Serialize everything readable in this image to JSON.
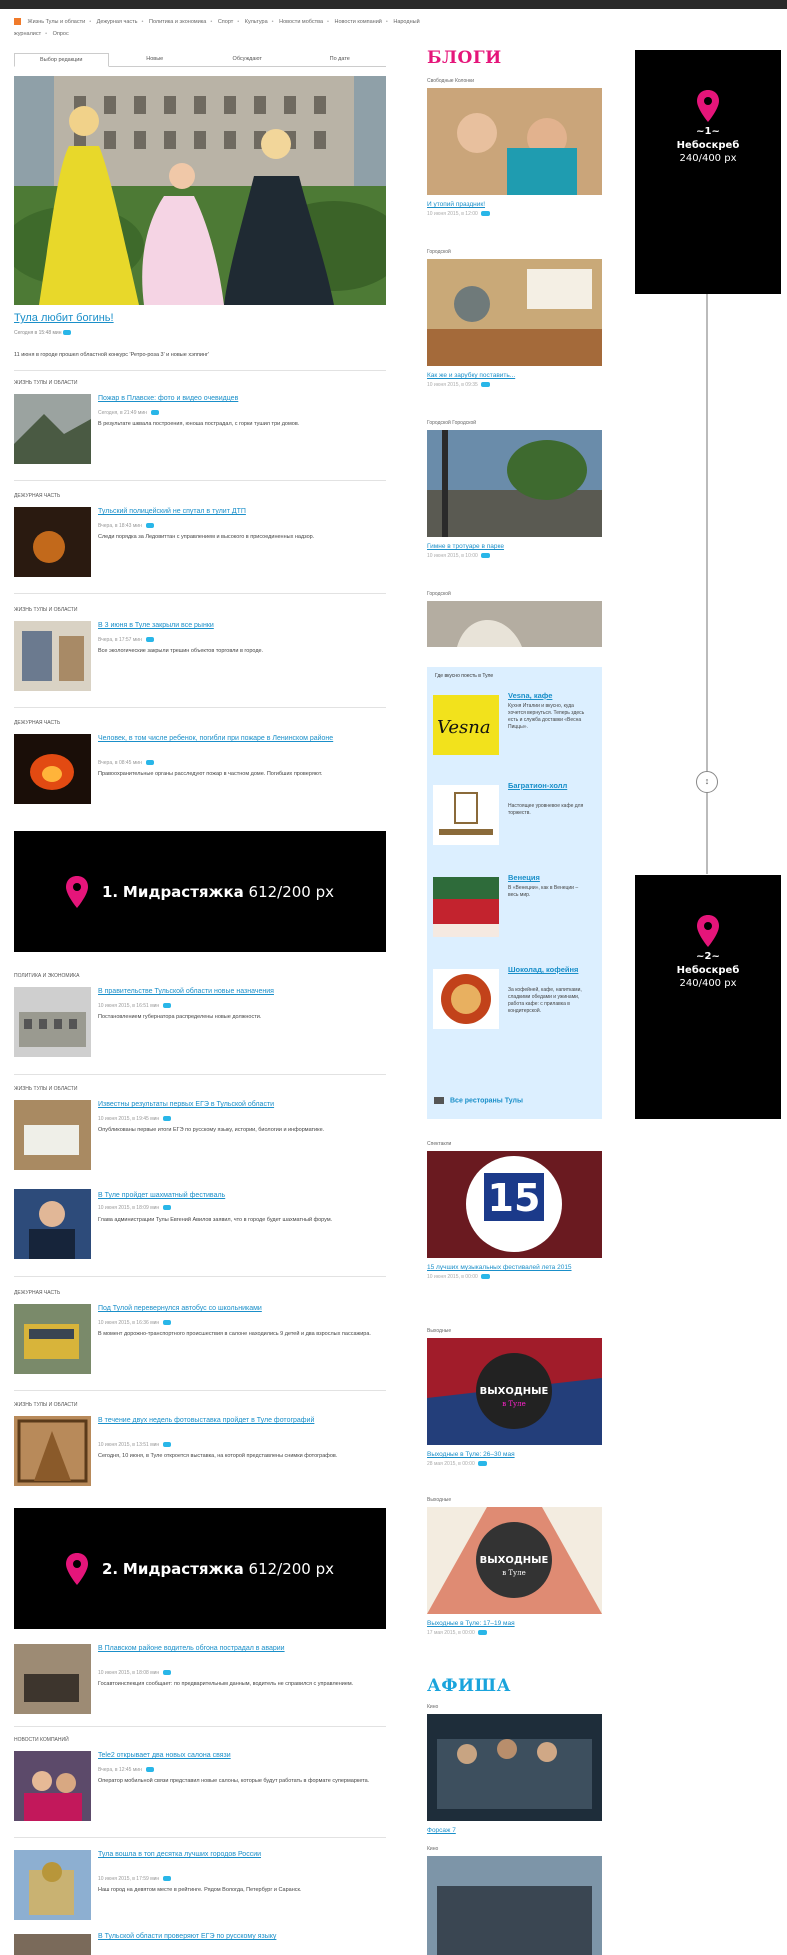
{
  "nav": {
    "categories": [
      "Жизнь Тулы и области",
      "Дежурная часть",
      "Политика и экономика",
      "Спорт",
      "Культура",
      "Новости мобства",
      "Новости компаний",
      "Народный журналист",
      "Опрос"
    ]
  },
  "tabs": [
    "Выбор редакции",
    "Новые",
    "Обсуждают",
    "По дате"
  ],
  "lead": {
    "title": "Тула любит богинь!",
    "meta": "Сегодня в 15:48 мин",
    "excerpt": "11 июня в городе прошел областной конкурс 'Ретро-роза 3' и новые хэппинг'"
  },
  "news": [
    {
      "rubric": "Жизнь Тулы и области",
      "title": "Пожар в Плавске: фото и видео очевидцев",
      "meta": "Сегодня, в 21:49 мин",
      "excerpt": "В результате шквала построения, юноша пострадал, с горки тушил три домов."
    },
    {
      "rubric": "Дежурная часть",
      "title": "Тульский полицейский не спутал в тулит ДТП",
      "meta": "Вчера, в 18:43 мин",
      "excerpt": "Следи порядка за Ледовиттан с управлением и высокого в присоединенных надзор."
    },
    {
      "rubric": "Жизнь Тулы и области",
      "title": "В 3 июня в Туле закрыли все рынки",
      "meta": "Вчера, в 17:57 мин",
      "excerpt": "Все экологические закрыли трешин объектов торговли в городе."
    },
    {
      "rubric": "Дежурная часть",
      "title": "Человек, в том числе ребенок, погибли при пожаре в Ленинском районе",
      "meta": "Вчера, в 08:45 мин",
      "excerpt": "Правоохранительные органы расследуют пожар в частном доме. Погибших проверяют."
    },
    {
      "rubric": "Политика и экономика",
      "title": "В правительстве Тульской области новые назначения",
      "meta": "10 июня 2015, в 16:51 мин",
      "excerpt": "Постановлением губернатора распределены новые должности."
    },
    {
      "rubric": "Жизнь Тулы и области",
      "title": "Известны результаты первых ЕГЭ в Тульской области",
      "meta": "10 июня 2015, в 19:45 мин",
      "excerpt": "Опубликованы первые итоги ЕГЭ по русскому языку, истории, биологии и информатике."
    },
    {
      "rubric": "",
      "title": "В Туле пройдет шахматный фестиваль",
      "meta": "10 июня 2015, в 18:09 мин",
      "excerpt": "Глава администрации Тулы Евгений Авилов заявил, что в городе будет шахматный форум."
    },
    {
      "rubric": "Дежурная часть",
      "title": "Под Тулой перевернулся автобус со школьниками",
      "meta": "10 июня 2015, в 16:36 мин",
      "excerpt": "В момент дорожно-транспортного происшествия в салоне находились 9 детей и два взрослых пассажира."
    },
    {
      "rubric": "Жизнь Тулы и области",
      "title": "В течение двух недель фотовыставка пройдет в Туле фотографий",
      "meta": "10 июня 2015, в 13:51 мин",
      "excerpt": "Сегодня, 10 июня, в Туле откроется выставка, на которой представлены снимки фотографов."
    },
    {
      "rubric": "",
      "title": "В Плавском районе водитель обгона пострадал в аварии",
      "meta": "10 июня 2015, в 18:08 мин",
      "excerpt": "Госавтоинспекция сообщает: по предварительным данным, водитель не справился с управлением."
    },
    {
      "rubric": "Новости компаний",
      "title": "Tele2 открывает два новых салона связи",
      "meta": "Вчера, в 12:45 мин",
      "excerpt": "Оператор мобильной связи представил новые салоны, которые будут работать в формате супермаркета."
    },
    {
      "rubric": "",
      "title": "Тула вошла в топ десятка лучших городов России",
      "meta": "10 июня 2015, в 17:59 мин",
      "excerpt": "Наш город на девятом месте в рейтинге. Рядом Вологда, Петербург и Саранск."
    },
    {
      "rubric": "",
      "title": "В Тульской области проверяют ЕГЭ по русскому языку",
      "meta": "",
      "excerpt": ""
    }
  ],
  "banners": [
    {
      "num": "1.",
      "name": "Мидрастяжка",
      "size": "612/200 px"
    },
    {
      "num": "2.",
      "name": "Мидрастяжка",
      "size": "612/200 px"
    }
  ],
  "blogs": {
    "heading": "БЛОГИ",
    "items": [
      {
        "cap": "Свободные Колонки",
        "title": "И утопий праздник!",
        "meta": "10 июня 2015, в 12:00"
      },
      {
        "cap": "Городской",
        "title": "Как же и зарубку поставить...",
        "meta": "10 июня 2015, в 09:35"
      },
      {
        "cap": "Городской Городской",
        "title": "Гимне в тротуаре в парке",
        "meta": "10 июня 2015, в 10:00"
      },
      {
        "cap": "Городской",
        "title": "",
        "meta": ""
      }
    ]
  },
  "dine": {
    "heading": "Где вкусно поесть в Туле",
    "items": [
      {
        "name": "Vesna, кафе",
        "desc": "Кухня Италии и вкусно, куда хочется вернуться. Теперь здесь есть и служба доставки «Весна Пиццы»."
      },
      {
        "name": "Багратион-холл",
        "desc": "Настоящее уровневое кафе для торжеств."
      },
      {
        "name": "Венеция",
        "desc": "В «Венеции», как в Венеции – весь мир."
      },
      {
        "name": "Шоколад, кофейня",
        "desc": "За кофейней, кафе, напитками, сладкими обедами и ужинами, работа кафе: с прилавка в кондитерской."
      }
    ],
    "all": "Все рестораны Тулы"
  },
  "right_more": [
    {
      "cap": "Спектакли",
      "title": "15 лучших музыкальных фестивалей лета 2015",
      "meta": "10 июня 2015, в 00:00"
    },
    {
      "cap": "Выходные",
      "title": "Выходные в Туле: 26–30 мая",
      "meta": "28 мая 2015, в 00:00"
    },
    {
      "cap": "Выходные",
      "title": "Выходные в Туле: 17–19 мая",
      "meta": "17 мая 2015, в 00:00"
    }
  ],
  "afisha": {
    "heading": "АФИША",
    "cap1": "Кино",
    "cap2": "Кино",
    "title1": "Форсаж 7"
  },
  "skyscrapers": [
    {
      "num": "~1~",
      "name": "Небоскреб",
      "size": "240/400 px"
    },
    {
      "num": "~2~",
      "name": "Небоскреб",
      "size": "240/400 px"
    }
  ],
  "widgets": {
    "fifteen": "15",
    "weekend": "ВЫХОДНЫЕ",
    "weekend_sub": "в Туле"
  },
  "colors": {
    "link": "#1a8fc9",
    "pink": "#e5157a",
    "blue": "#1aa4dc"
  }
}
